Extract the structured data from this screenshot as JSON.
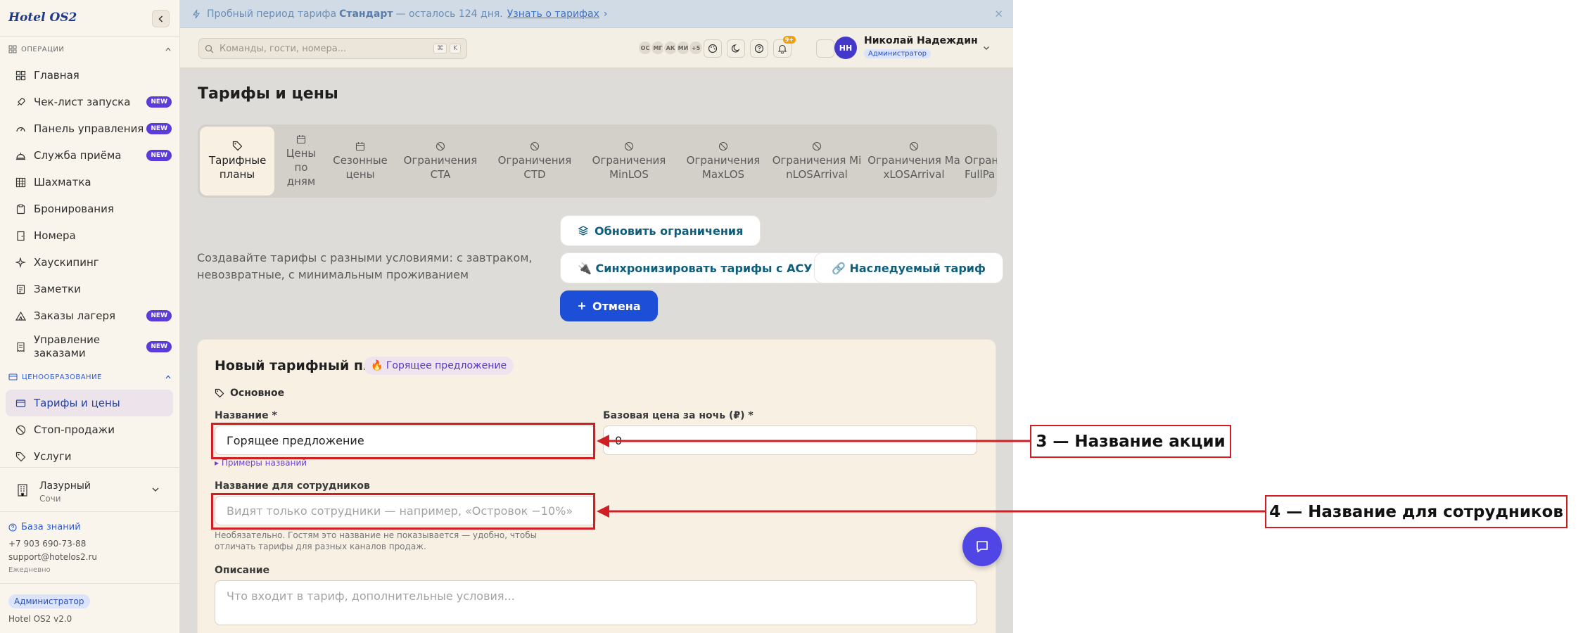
{
  "sidebar": {
    "logo": "Hotel OS2",
    "sections": {
      "operations": "ОПЕРАЦИИ",
      "pricing": "ЦЕНООБРАЗОВАНИЕ"
    },
    "items": [
      {
        "label": "Главная",
        "icon": "home-icon"
      },
      {
        "label": "Чек-лист запуска",
        "icon": "rocket-icon",
        "badge": "NEW"
      },
      {
        "label": "Панель управления",
        "icon": "gauge-icon",
        "badge": "NEW"
      },
      {
        "label": "Служба приёма",
        "icon": "bell-concierge-icon",
        "badge": "NEW"
      },
      {
        "label": "Шахматка",
        "icon": "grid-icon"
      },
      {
        "label": "Бронирования",
        "icon": "clipboard-icon"
      },
      {
        "label": "Номера",
        "icon": "door-icon"
      },
      {
        "label": "Хаускипинг",
        "icon": "sparkles-icon"
      },
      {
        "label": "Заметки",
        "icon": "note-icon"
      },
      {
        "label": "Заказы лагеря",
        "icon": "tent-icon",
        "badge": "NEW"
      },
      {
        "label": "Управление заказами",
        "icon": "receipt-icon",
        "badge": "NEW"
      }
    ],
    "pricing_items": [
      {
        "label": "Тарифы и цены",
        "icon": "rate-card-icon"
      },
      {
        "label": "Стоп-продажи",
        "icon": "ban-icon"
      },
      {
        "label": "Услуги",
        "icon": "tag-icon"
      }
    ],
    "hotel": {
      "name": "Лазурный",
      "city": "Сочи"
    },
    "support": {
      "kb": "База знаний",
      "phone": "+7 903 690-73-88",
      "email": "support@hotelos2.ru",
      "hours": "Ежедневно"
    },
    "role": "Администратор",
    "version": "Hotel OS2 v2.0"
  },
  "trial": {
    "prefix": "Пробный период тарифа",
    "plan": "Стандарт",
    "suffix": "— осталось 124 дня.",
    "link": "Узнать о тарифах"
  },
  "topbar": {
    "search_placeholder": "Команды, гости, номера...",
    "kbd1": "⌘",
    "kbd2": "K",
    "avatars": [
      "ОС",
      "МГ",
      "АК",
      "МИ",
      "+5"
    ],
    "notif_count": "9+",
    "user_initials": "НН",
    "user_name": "Николай Надеждин",
    "user_role": "Администратор"
  },
  "page": {
    "title": "Тарифы и цены",
    "tabs": [
      {
        "label": "Тарифные планы",
        "icon": "tag-icon"
      },
      {
        "label": "Цены по дням",
        "icon": "calendar-icon"
      },
      {
        "label": "Сезонные цены",
        "icon": "calendar-icon"
      },
      {
        "label": "Ограничения CTA",
        "icon": "ban-icon"
      },
      {
        "label": "Ограничения CTD",
        "icon": "ban-icon"
      },
      {
        "label": "Ограничения MinLOS",
        "icon": "ban-icon"
      },
      {
        "label": "Ограничения MaxLOS",
        "icon": "ban-icon"
      },
      {
        "label": "Ограничения MinLOSArrival",
        "icon": "ban-icon"
      },
      {
        "label": "Ограничения MaxLOSArrival",
        "icon": "ban-icon"
      },
      {
        "label": "Ограничения FullPa",
        "icon": "ban-icon"
      }
    ],
    "description": "Создавайте тарифы с разными условиями: с завтраком, невозвратные, с минимальным проживанием",
    "buttons": {
      "update": "Обновить ограничения",
      "sync": "🔌 Синхронизировать тарифы с АСУ",
      "inherit": "🔗 Наследуемый тариф",
      "cancel": "Отмена"
    }
  },
  "form": {
    "title": "Новый тарифный план",
    "badge": "🔥 Горящее предложение",
    "section": "Основное",
    "name_label": "Название *",
    "name_value": "Горящее предложение",
    "examples_link": "▸ Примеры названий",
    "price_label": "Базовая цена за ночь (₽) *",
    "price_value": "0",
    "staff_label": "Название для сотрудников",
    "staff_placeholder": "Видят только сотрудники — например, «Островок −10%»",
    "staff_hint": "Необязательно. Гостям это название не показывается — удобно, чтобы отличать тарифы для разных каналов продаж.",
    "desc_label": "Описание",
    "desc_placeholder": "Что входит в тариф, дополнительные условия..."
  },
  "annotations": {
    "a3": "3 — Название акции",
    "a4": "4 — Название для сотрудников"
  },
  "colors": {
    "accent": "#1d4ed8",
    "brand_badge": "#5b3bd9",
    "annotation": "#d11d24"
  }
}
